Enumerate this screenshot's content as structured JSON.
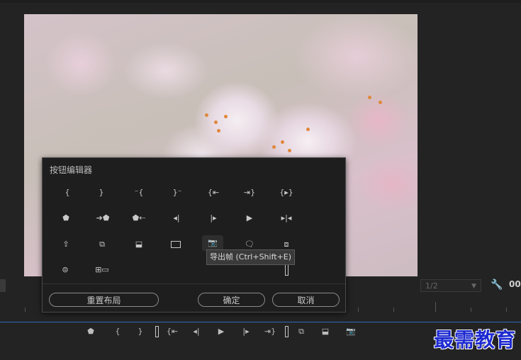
{
  "dialog": {
    "title": "按钮编辑器",
    "buttons": [
      {
        "icon": "mark-in-icon",
        "glyph": "{"
      },
      {
        "icon": "mark-out-icon",
        "glyph": "}"
      },
      {
        "icon": "clear-in-icon",
        "glyph": "⁻{"
      },
      {
        "icon": "clear-out-icon",
        "glyph": "}⁻"
      },
      {
        "icon": "go-to-in-icon",
        "glyph": "{⇤"
      },
      {
        "icon": "go-to-out-icon",
        "glyph": "⇥}"
      },
      {
        "icon": "play-in-to-out-icon",
        "glyph": "{▸}"
      },
      {
        "icon": "add-marker-icon",
        "glyph": "⬟"
      },
      {
        "icon": "go-to-next-marker-icon",
        "glyph": "➔⬟"
      },
      {
        "icon": "go-to-previous-marker-icon",
        "glyph": "⬟⇠"
      },
      {
        "icon": "step-back-icon",
        "glyph": "◂|"
      },
      {
        "icon": "step-forward-icon",
        "glyph": "|▸"
      },
      {
        "icon": "play-stop-icon",
        "glyph": "▶"
      },
      {
        "icon": "play-around-icon",
        "glyph": "▸|◂"
      },
      {
        "icon": "lift-icon",
        "glyph": "⇪"
      },
      {
        "icon": "insert-icon",
        "glyph": "⧉"
      },
      {
        "icon": "overwrite-icon",
        "glyph": "⬓"
      },
      {
        "icon": "safe-margins-icon",
        "glyph": "▭"
      },
      {
        "icon": "export-frame-icon",
        "glyph": "📷"
      },
      {
        "icon": "closed-captions-icon",
        "glyph": "🗨"
      },
      {
        "icon": "toggle-proxies-icon",
        "glyph": "⧈"
      },
      {
        "icon": "vr-video-icon",
        "glyph": "⊜"
      },
      {
        "icon": "multi-camera-icon",
        "glyph": "⊞▭"
      }
    ],
    "tooltip": "导出帧 (Ctrl+Shift+E)",
    "reset_label": "重置布局",
    "ok_label": "确定",
    "cancel_label": "取消"
  },
  "monitor": {
    "resolution": "1/2",
    "timecode": "00"
  },
  "transport": [
    {
      "icon": "add-marker-icon",
      "glyph": "⬟"
    },
    {
      "icon": "mark-in-icon",
      "glyph": "{"
    },
    {
      "icon": "mark-out-icon",
      "glyph": "}"
    },
    {
      "icon": "go-to-in-icon",
      "glyph": "{⇤"
    },
    {
      "icon": "step-back-icon",
      "glyph": "◂|"
    },
    {
      "icon": "play-stop-icon",
      "glyph": "▶"
    },
    {
      "icon": "step-forward-icon",
      "glyph": "|▸"
    },
    {
      "icon": "go-to-out-icon",
      "glyph": "⇥}"
    },
    {
      "icon": "insert-icon",
      "glyph": "⧉"
    },
    {
      "icon": "overwrite-icon",
      "glyph": "⬓"
    },
    {
      "icon": "export-frame-icon",
      "glyph": "📷"
    }
  ],
  "watermark": "最需教育"
}
